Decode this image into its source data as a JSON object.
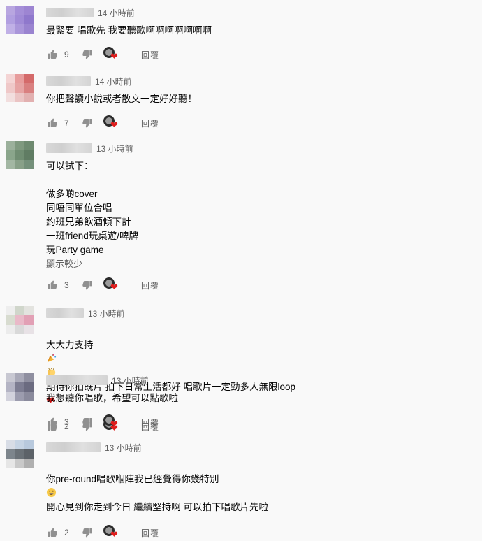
{
  "comments": [
    {
      "time": "14 小時前",
      "text": "最緊要 唱歌先 我要聽歌啊啊啊啊啊啊啊",
      "likes": "9",
      "reply": "回覆",
      "avatar": [
        "#b8a6e0",
        "#a58fd8",
        "#9d85d2",
        "#b19fe0",
        "#a08ad6",
        "#8f78cc",
        "#c0b0e6",
        "#aa96da",
        "#9a84d0"
      ]
    },
    {
      "time": "14 小時前",
      "text": "你把聲讀小說或者散文一定好好聽！",
      "likes": "7",
      "reply": "回覆",
      "avatar": [
        "#f4d4d4",
        "#e79c9c",
        "#d46a6a",
        "#efc8c8",
        "#e6a3a3",
        "#d98080",
        "#f2dede",
        "#ebc4c4",
        "#e2b0b0"
      ]
    },
    {
      "time": "13 小時前",
      "text": "可以試下：\n\n做多啲cover\n同唔同單位合唱\n約班兄弟飲酒傾下計\n一班friend玩桌遊/啤牌\n玩Party game",
      "show_less": "顯示較少",
      "likes": "3",
      "reply": "回覆",
      "avatar": [
        "#9bb09b",
        "#7f997f",
        "#6e8a70",
        "#8aa58b",
        "#708d72",
        "#607c63",
        "#a3b7a3",
        "#88a088",
        "#74907a"
      ]
    },
    {
      "time": "13 小時前",
      "text_before_emoji": "大大力支持",
      "text_after_emoji": " 期待你拍既片 拍下日常生活都好 唱歌片一定勁多人無限loop",
      "likes": "2",
      "reply": "回覆",
      "avatar": [
        "#eeeeee",
        "#d0d6cb",
        "#e3e3df",
        "#d8dcd0",
        "#e9b9c8",
        "#e2a0b5",
        "#ececec",
        "#d9d9d9",
        "#e8e2e6"
      ]
    },
    {
      "time": "13 小時前",
      "text": "我想聽你唱歌，希望可以點歌啦",
      "likes": "3",
      "reply": "回覆",
      "avatar": [
        "#c8c8d2",
        "#a9a9b8",
        "#8f8fa0",
        "#b4b4c4",
        "#7d7d92",
        "#6b6b80",
        "#d2d2dc",
        "#9c9cae",
        "#8a8a9c"
      ]
    },
    {
      "time": "13 小時前",
      "text_before_emoji": "你pre-round唱歌嗰陣我已經覺得你幾特別",
      "text_after_emoji": "開心見到你走到今日 繼續堅持啊 可以拍下唱歌片先啦",
      "likes": "2",
      "reply": "回覆",
      "avatar": [
        "#d8dde6",
        "#c6d4e4",
        "#b8c9dd",
        "#7d858c",
        "#6a7177",
        "#5c6268",
        "#e6e6e6",
        "#c9c9c9",
        "#b0b0b0"
      ]
    }
  ],
  "icons": {
    "like": "thumbs-up-icon",
    "dislike": "thumbs-down-icon",
    "creator_heart": "heart-icon",
    "party": "party-popper-emoji",
    "clap": "clapping-emoji",
    "heart_emoji": "red-heart-emoji",
    "grin": "grinning-emoji"
  },
  "colors": {
    "heart": "#e01c1c",
    "secondary_text": "#606060",
    "background": "#f9f9f9"
  }
}
